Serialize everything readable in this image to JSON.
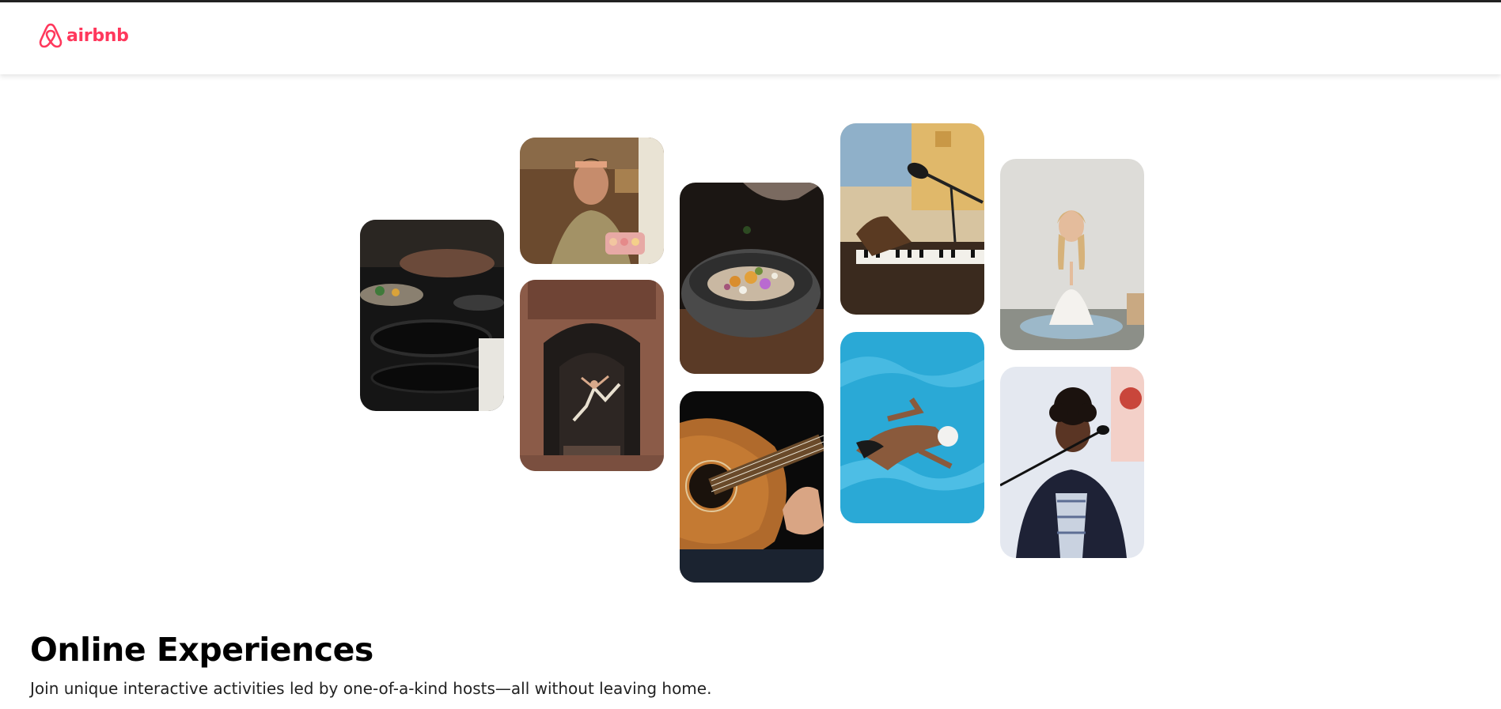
{
  "header": {
    "logo_text": "airbnb",
    "logo_icon": "airbnb-belo-icon",
    "brand_color": "#FF385C"
  },
  "gallery": {
    "photos": [
      {
        "subject": "cooking-pans-photo"
      },
      {
        "subject": "woman-holding-macarons-photo"
      },
      {
        "subject": "dancer-in-doorway-photo"
      },
      {
        "subject": "bowl-of-food-photo"
      },
      {
        "subject": "acoustic-guitar-photo"
      },
      {
        "subject": "piano-and-microphone-photo"
      },
      {
        "subject": "swimmer-in-pool-photo"
      },
      {
        "subject": "woman-meditating-photo"
      },
      {
        "subject": "singer-at-microphone-photo"
      }
    ]
  },
  "main": {
    "title": "Online Experiences",
    "subtitle": "Join unique interactive activities led by one-of-a-kind hosts—all without leaving home."
  }
}
